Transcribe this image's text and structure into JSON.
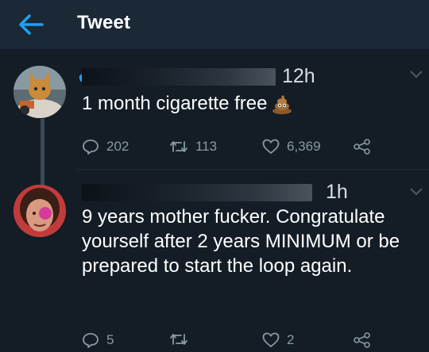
{
  "header": {
    "title": "Tweet"
  },
  "tweets": [
    {
      "time": "12h",
      "text": "1 month cigarette free",
      "emoji": "poop-emoji",
      "reply_count": "202",
      "retweet_count": "113",
      "like_count": "6,369"
    },
    {
      "time": "1h",
      "text": "9 years mother fucker. Congratulate yourself after 2 years MINIMUM or be prepared to start the loop again.",
      "reply_count": "5",
      "retweet_count": "",
      "like_count": "2"
    }
  ],
  "colors": {
    "background": "#141d26",
    "header": "#1b2836",
    "accent": "#1da1f2",
    "muted": "#8899a6"
  }
}
